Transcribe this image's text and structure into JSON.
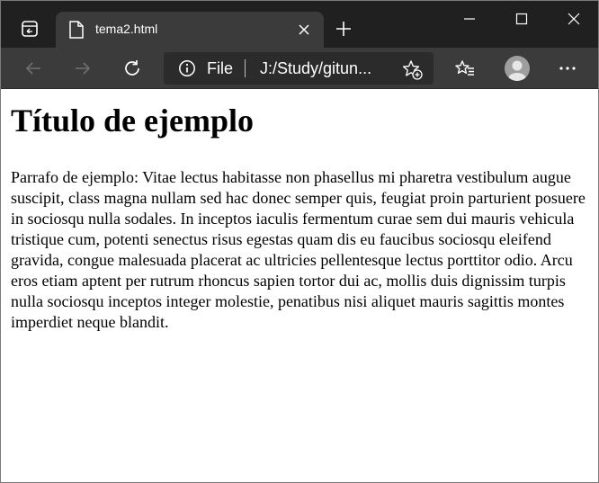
{
  "tab": {
    "title": "tema2.html"
  },
  "address": {
    "scheme": "File",
    "url": "J:/Study/gitun..."
  },
  "page": {
    "heading": "Título de ejemplo",
    "paragraph": "Parrafo de ejemplo: Vitae lectus habitasse non phasellus mi pharetra vestibulum augue suscipit, class magna nullam sed hac donec semper quis, feugiat proin parturient posuere in sociosqu nulla sodales. In inceptos iaculis fermentum curae sem dui mauris vehicula tristique cum, potenti senectus risus egestas quam dis eu faucibus sociosqu eleifend gravida, congue malesuada placerat ac ultricies pellentesque lectus porttitor odio. Arcu eros etiam aptent per rutrum rhoncus sapien tortor dui ac, mollis duis dignissim turpis nulla sociosqu inceptos integer molestie, penatibus nisi aliquet mauris sagittis montes imperdiet neque blandit."
  },
  "colors": {
    "tabstrip_bg": "#202020",
    "toolbar_bg": "#3b3b3b",
    "address_bg": "#2b2b2b",
    "page_bg": "#ffffff",
    "text": "#000000"
  },
  "icons": {
    "tab_actions": "tab-actions-icon",
    "favicon": "page-icon",
    "close_tab": "close-icon",
    "new_tab": "plus-icon",
    "minimize": "minimize-icon",
    "maximize": "maximize-icon",
    "close_window": "close-icon",
    "back": "back-arrow-icon",
    "forward": "forward-arrow-icon",
    "refresh": "refresh-icon",
    "site_info": "info-icon",
    "add_favorite": "star-plus-icon",
    "favorites": "favorites-icon",
    "profile": "avatar",
    "menu": "more-icon"
  }
}
